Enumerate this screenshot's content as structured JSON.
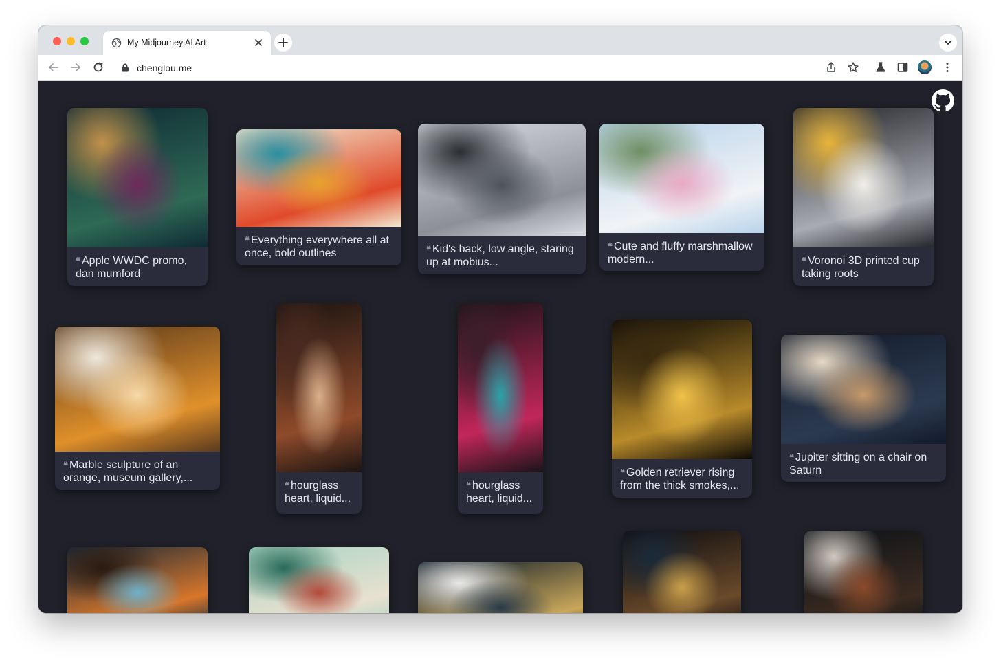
{
  "browser": {
    "tab_title": "My Midjourney AI Art",
    "url": "chenglou.me"
  },
  "icons": {
    "traffic_lights": [
      "close-light",
      "minimize-light",
      "zoom-light"
    ],
    "tab": [
      "globe-icon",
      "close-icon",
      "plus-icon",
      "chevron-down-icon"
    ],
    "toolbar": [
      "back-arrow-icon",
      "forward-arrow-icon",
      "reload-icon",
      "lock-icon",
      "share-icon",
      "star-icon",
      "flask-icon",
      "sidebar-icon",
      "profile-avatar-icon",
      "more-vertical-icon"
    ],
    "page": [
      "github-icon",
      "quote-icon"
    ]
  },
  "colors": {
    "page_background": "#20212a",
    "card_background": "#2a2c3b",
    "caption_text": "#e4e6ee",
    "tab_strip": "#dee1e6"
  },
  "gallery": {
    "quote_mark": "❝",
    "cards": [
      {
        "caption": "Apple WWDC promo, dan mumford",
        "palette": [
          "#0f2a34",
          "#2e6a55",
          "#6f2a5c",
          "#c2904a"
        ]
      },
      {
        "caption": "Everything everywhere all at once, bold outlines",
        "palette": [
          "#f2e8d0",
          "#e04a2a",
          "#e8a12e",
          "#2a8fa0"
        ]
      },
      {
        "caption": "Kid's back, low angle, staring up at mobius...",
        "palette": [
          "#d9dde2",
          "#8c9096",
          "#4e5359",
          "#2b2e33"
        ]
      },
      {
        "caption": "Cute and fluffy marshmallow modern...",
        "palette": [
          "#b8d3ea",
          "#f1f3f6",
          "#e9a9c3",
          "#6f8f63"
        ]
      },
      {
        "caption": "Voronoi 3D printed cup taking roots",
        "palette": [
          "#24262b",
          "#a9abb2",
          "#f1efe9",
          "#e8b43a"
        ]
      },
      {
        "caption": "Marble sculpture of an orange, museum gallery,...",
        "palette": [
          "#5a3a1e",
          "#e0902a",
          "#f7d9a8",
          "#efe8dc"
        ]
      },
      {
        "caption": "hourglass heart, liquid...",
        "palette": [
          "#1b1412",
          "#8e4a2a",
          "#d9b08a",
          "#4a2a20"
        ]
      },
      {
        "caption": "hourglass heart, liquid...",
        "palette": [
          "#1a1418",
          "#c2265a",
          "#2aa3a8",
          "#3b1f2a"
        ]
      },
      {
        "caption": "Golden retriever rising from the thick smokes,...",
        "palette": [
          "#0c0a06",
          "#b88a2a",
          "#f0c24a",
          "#3a2a10"
        ]
      },
      {
        "caption": "Jupiter sitting on a chair on Saturn",
        "palette": [
          "#121a2a",
          "#2c3a50",
          "#c79a6a",
          "#e6d8c4"
        ]
      },
      {
        "caption": "",
        "palette": [
          "#1a2a3a",
          "#d8762a",
          "#6fb0c8",
          "#2a1a10"
        ]
      },
      {
        "caption": "",
        "palette": [
          "#a9d5c3",
          "#e8e0d0",
          "#b34a3a",
          "#2a6a5a"
        ]
      },
      {
        "caption": "",
        "palette": [
          "#0a1a2a",
          "#c9a75a",
          "#2a3a4a",
          "#e8e8e8"
        ]
      },
      {
        "caption": "",
        "palette": [
          "#0c0d12",
          "#6a4a2a",
          "#c9a04a",
          "#1a2a3a"
        ]
      },
      {
        "caption": "",
        "palette": [
          "#0c1218",
          "#3a2a20",
          "#8a4a2a",
          "#d0c8c0"
        ]
      }
    ]
  }
}
